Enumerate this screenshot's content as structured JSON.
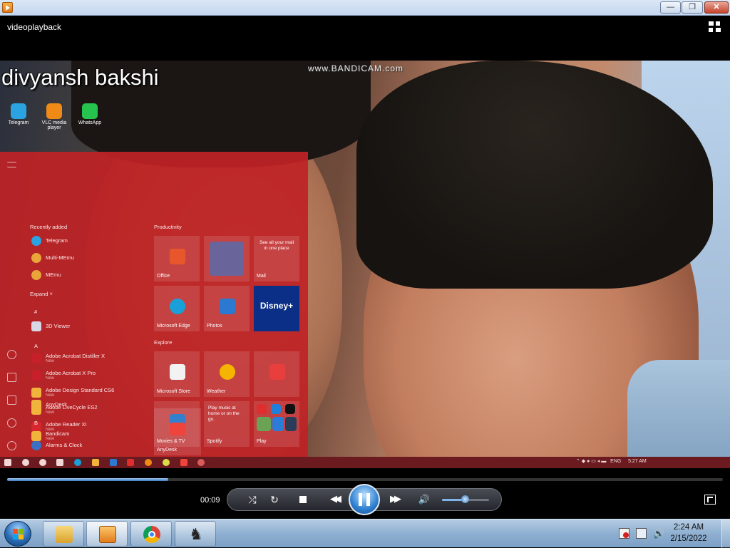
{
  "window": {
    "title": "",
    "minimize_icon": "minimize-icon",
    "maximize_icon": "restore-icon",
    "close_icon": "close-icon",
    "minimize_glyph": "—",
    "maximize_glyph": "❐",
    "close_glyph": "✕"
  },
  "header": {
    "video_title": "videoplayback",
    "switch_view_icon": "switch-to-library-icon"
  },
  "video": {
    "overlay_name": "divyansh bakshi",
    "watermark": "www.BANDICAM.com",
    "desktop_icons": [
      {
        "label": "Telegram",
        "icon": "telegram-icon",
        "color": "#2aa3e0"
      },
      {
        "label": "VLC media player",
        "icon": "vlc-icon",
        "color": "#f08a16"
      },
      {
        "label": "WhatsApp",
        "icon": "whatsapp-icon",
        "color": "#26c44e"
      }
    ],
    "start_menu": {
      "recently_added": "Recently added",
      "expand": "Expand  ˅",
      "recent_apps": [
        {
          "label": "Telegram",
          "color": "#2aa3e0"
        },
        {
          "label": "Multi-MEmu",
          "color": "#e9a53a"
        },
        {
          "label": "MEmu",
          "color": "#e9a53a"
        }
      ],
      "section_hash": "#",
      "section_a": "A",
      "section_b": "B",
      "apps": [
        {
          "label": "3D Viewer",
          "sub": "",
          "color": "#d7d7e6"
        },
        {
          "label": "Adobe Acrobat Distiller X",
          "sub": "New",
          "color": "#c8202a"
        },
        {
          "label": "Adobe Acrobat X Pro",
          "sub": "New",
          "color": "#c8202a"
        },
        {
          "label": "Adobe Design Standard CS6",
          "sub": "New",
          "color": "#f0b43c"
        },
        {
          "label": "Adobe LiveCycle ES2",
          "sub": "New",
          "color": "#f0b43c"
        },
        {
          "label": "Adobe Reader XI",
          "sub": "New",
          "color": "#d6262e"
        },
        {
          "label": "Alarms & Clock",
          "sub": "",
          "color": "#3a6fc4"
        },
        {
          "label": "AnyDesk",
          "sub": "",
          "color": "#f0b43c"
        },
        {
          "label": "Bandicam",
          "sub": "New",
          "color": "#f0b43c"
        }
      ],
      "productivity": "Productivity",
      "explore": "Explore",
      "tiles": [
        {
          "label": "Office",
          "color": "#e8572c",
          "text": ""
        },
        {
          "label": "",
          "color": "#2b7cd3",
          "text": ""
        },
        {
          "label": "Mail",
          "color": "#1e73c8",
          "text": "See all your mail in one place"
        },
        {
          "label": "Microsoft Edge",
          "color": "#1aa0d8",
          "text": ""
        },
        {
          "label": "Photos",
          "color": "#2b79d0",
          "text": ""
        },
        {
          "label": "",
          "color": "#0a2a7a",
          "text": "Disney+"
        },
        {
          "label": "Microsoft Store",
          "color": "#f2f2f2",
          "text": ""
        },
        {
          "label": "Weather",
          "color": "#f5b400",
          "text": ""
        },
        {
          "label": "",
          "color": "#e83e3e",
          "text": ""
        },
        {
          "label": "Movies & TV",
          "color": "#1a6fc8",
          "text": ""
        },
        {
          "label": "Spotify",
          "color": "#1db954",
          "text": "Play music at home or on the go."
        },
        {
          "label": "Play",
          "color": "#333",
          "text": ""
        },
        {
          "label": "AnyDesk",
          "color": "#ef443b",
          "text": ""
        }
      ]
    },
    "inner_taskbar": {
      "language": "ENG",
      "time": "5:27 AM"
    }
  },
  "controls": {
    "elapsed": "00:09",
    "progress_fraction": 0.225,
    "volume_fraction": 0.5,
    "icons": {
      "shuffle": "shuffle-icon",
      "repeat": "repeat-icon",
      "stop": "stop-icon",
      "previous": "previous-icon",
      "play_pause": "pause-icon",
      "next": "next-icon",
      "mute": "volume-icon",
      "fullscreen": "switch-to-now-playing-icon"
    },
    "glyphs": {
      "shuffle": "⤮",
      "repeat": "↻",
      "previous": "◀◀",
      "next": "▶▶",
      "mute": "🔊"
    }
  },
  "taskbar": {
    "time": "2:24 AM",
    "date": "2/15/2022",
    "pinned": [
      {
        "name": "windows-explorer",
        "icon": "folder-icon"
      },
      {
        "name": "windows-media-player",
        "icon": "media-player-icon"
      },
      {
        "name": "google-chrome",
        "icon": "chrome-icon"
      },
      {
        "name": "chess-titans",
        "icon": "chess-icon"
      }
    ],
    "tray_icons": [
      "action-center-icon",
      "network-icon",
      "volume-icon"
    ]
  }
}
